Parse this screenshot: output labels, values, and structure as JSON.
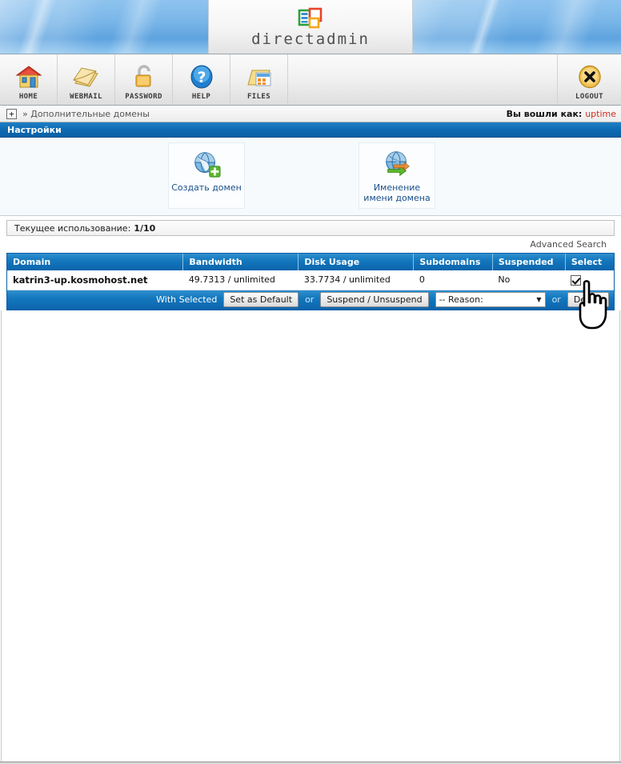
{
  "header": {
    "logo_word": "directadmin",
    "logo_icon": "directadmin-logo-icon"
  },
  "nav": {
    "items": [
      {
        "label": "HOME",
        "icon": "house-icon"
      },
      {
        "label": "WEBMAIL",
        "icon": "envelope-icon"
      },
      {
        "label": "PASSWORD",
        "icon": "padlock-icon"
      },
      {
        "label": "HELP",
        "icon": "question-mark-icon"
      },
      {
        "label": "FILES",
        "icon": "folder-files-icon"
      }
    ],
    "logout": {
      "label": "LOGOUT",
      "icon": "x-circle-icon"
    }
  },
  "breadcrumb": {
    "expand_glyph": "+",
    "path": "» Дополнительные домены",
    "logged_in_label": "Вы вошли как:",
    "username": "uptime"
  },
  "section": {
    "title": "Настройки"
  },
  "panel": {
    "tiles": [
      {
        "caption": "Создать домен",
        "icon": "globe-add-icon"
      },
      {
        "caption": "Именение имени домена",
        "icon": "globe-rename-icon"
      }
    ]
  },
  "usage": {
    "label": "Текущее использование:",
    "value": "1/10"
  },
  "search": {
    "advanced_label": "Advanced Search"
  },
  "table": {
    "columns": [
      "Domain",
      "Bandwidth",
      "Disk Usage",
      "Subdomains",
      "Suspended",
      "Select"
    ],
    "rows": [
      {
        "domain": "katrin3-up.kosmohost.net",
        "bandwidth": "49.7313 / unlimited",
        "disk_usage": "33.7734 / unlimited",
        "subdomains": "0",
        "suspended": "No",
        "selected": true
      }
    ]
  },
  "actions": {
    "with_selected_label": "With Selected",
    "set_default_label": "Set as Default",
    "or_label_1": "or",
    "suspend_label": "Suspend / Unsuspend",
    "reason_selected": "-- Reason:",
    "caret": "▼",
    "or_label_2": "or",
    "delete_label": "Delete"
  },
  "colors": {
    "accent_blue": "#0c64ab",
    "header_blue": "#1478be",
    "link_red": "#d42b1e",
    "tile_link": "#1a4f8a"
  }
}
